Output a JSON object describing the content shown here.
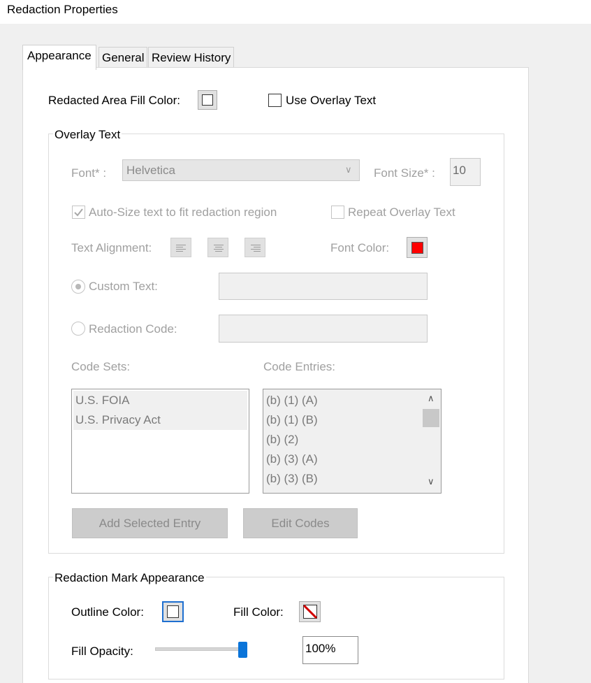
{
  "window": {
    "title": "Redaction Properties"
  },
  "tabs": [
    {
      "label": "Appearance"
    },
    {
      "label": "General"
    },
    {
      "label": "Review History"
    }
  ],
  "appearance": {
    "fill_color_label": "Redacted Area Fill Color:",
    "use_overlay_label": "Use Overlay Text",
    "overlay_group": {
      "title": "Overlay Text",
      "font_label": "Font* :",
      "font_value": "Helvetica",
      "font_size_label": "Font Size* :",
      "font_size_value": "10",
      "autosize_label": "Auto-Size text to fit redaction region",
      "repeat_label": "Repeat Overlay Text",
      "text_alignment_label": "Text Alignment:",
      "font_color_label": "Font Color:",
      "font_color": "#ff0000",
      "custom_text_label": "Custom Text:",
      "redaction_code_label": "Redaction Code:",
      "code_sets_label": "Code Sets:",
      "code_entries_label": "Code Entries:",
      "code_sets": [
        "U.S. FOIA",
        "U.S. Privacy Act"
      ],
      "code_entries": [
        "(b) (1) (A)",
        "(b) (1) (B)",
        "(b) (2)",
        "(b) (3) (A)",
        "(b) (3) (B)"
      ],
      "add_selected_label": "Add Selected Entry",
      "edit_codes_label": "Edit Codes"
    },
    "mark_group": {
      "title": "Redaction Mark Appearance",
      "outline_color_label": "Outline Color:",
      "fill_color_label": "Fill Color:",
      "fill_opacity_label": "Fill Opacity:",
      "fill_opacity_value": "100%",
      "fill_opacity_fraction": 1.0
    }
  }
}
